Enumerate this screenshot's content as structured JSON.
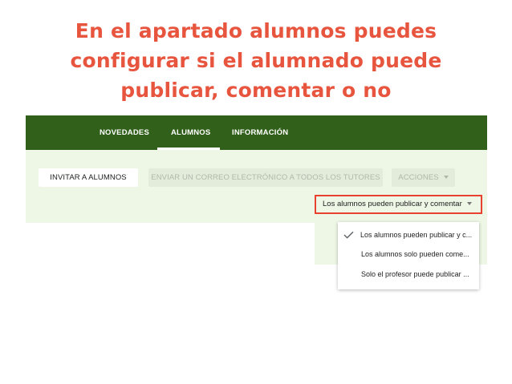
{
  "slide": {
    "title_lines": [
      "En el apartado alumnos puedes",
      "configurar si el alumnado puede",
      "publicar, comentar o no"
    ],
    "title_color": "#e8553e"
  },
  "nav": {
    "tabs": [
      "NOVEDADES",
      "ALUMNOS",
      "INFORMACIÓN"
    ],
    "active_tab": "ALUMNOS",
    "bar_color": "#31601b"
  },
  "toolbar": {
    "invite_label": "INVITAR A ALUMNOS",
    "email_label": "ENVIAR UN CORREO ELECTRÓNICO A TODOS LOS TUTORES",
    "actions_label": "ACCIONES"
  },
  "permissions": {
    "selected": "Los alumnos pueden publicar y comentar",
    "highlight_color": "#e8412f",
    "options": [
      {
        "label": "Los alumnos pueden publicar y c...",
        "checked": true
      },
      {
        "label": "Los alumnos solo pueden come...",
        "checked": false
      },
      {
        "label": "Solo el profesor puede publicar ...",
        "checked": false
      }
    ]
  },
  "icons": {
    "check": "check-icon",
    "dropdown_caret": "caret-down-icon"
  }
}
